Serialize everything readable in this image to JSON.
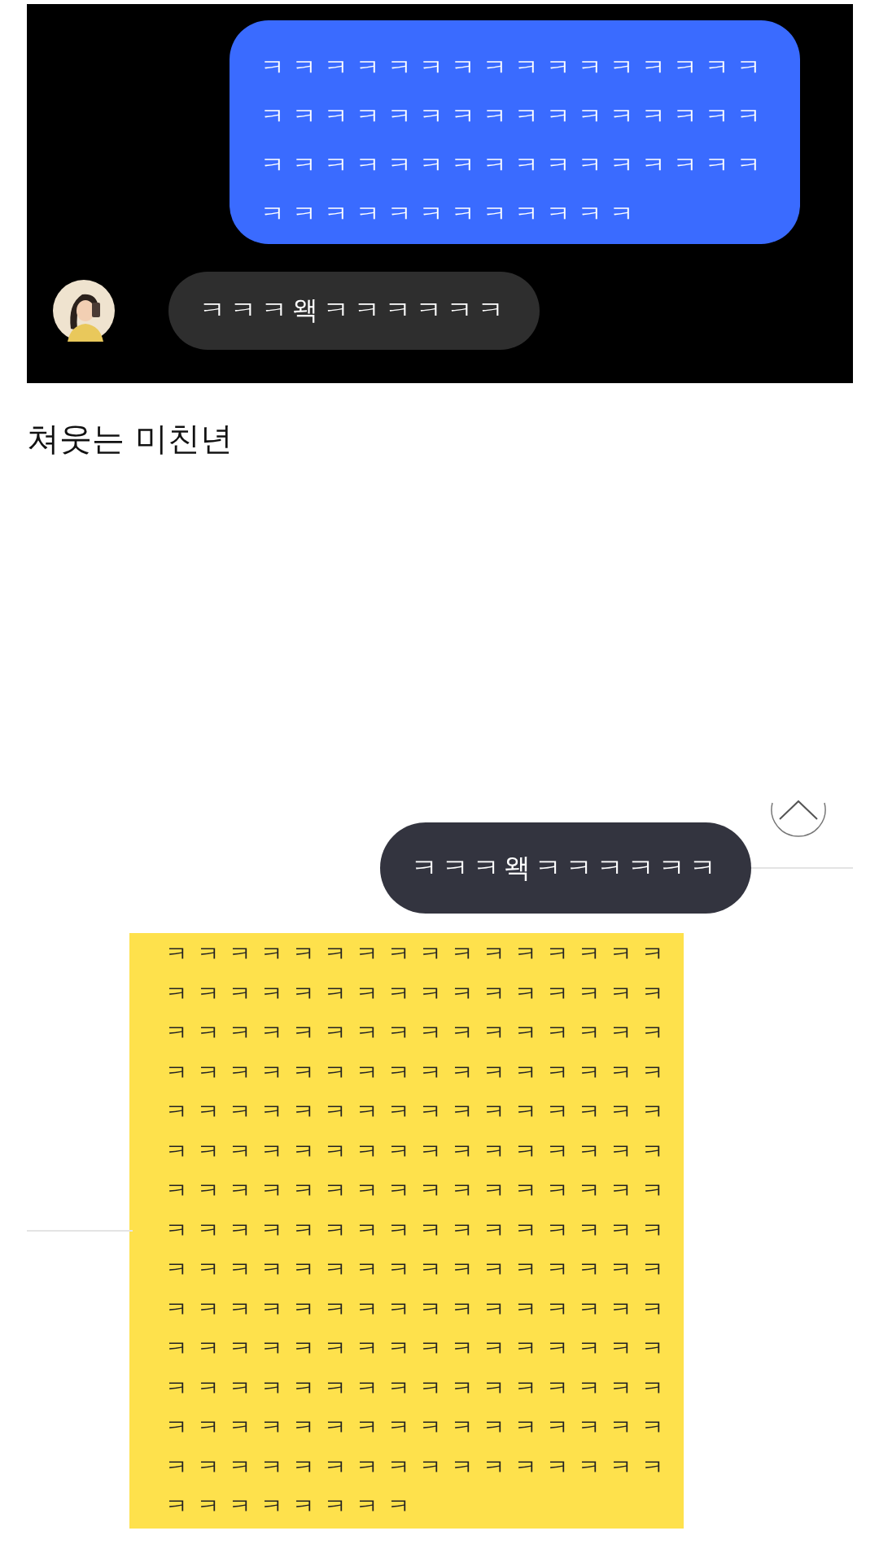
{
  "chat_screenshot": {
    "sent_message": {
      "lines": [
        "ㅋㅋㅋㅋㅋㅋㅋㅋㅋㅋㅋㅋㅋㅋㅋㅋ",
        "ㅋㅋㅋㅋㅋㅋㅋㅋㅋㅋㅋㅋㅋㅋㅋㅋ",
        "ㅋㅋㅋㅋㅋㅋㅋㅋㅋㅋㅋㅋㅋㅋㅋㅋ",
        "ㅋㅋㅋㅋㅋㅋㅋㅋㅋㅋㅋㅋ"
      ]
    },
    "received_message": {
      "text": "ㅋㅋㅋ왝ㅋㅋㅋㅋㅋㅋ"
    }
  },
  "caption": "쳐웃는 미친년",
  "reply_screenshot": {
    "message": {
      "text": "ㅋㅋㅋ왝ㅋㅋㅋㅋㅋㅋ"
    },
    "note_lines": [
      "ㅋㅋㅋㅋㅋㅋㅋㅋㅋㅋㅋㅋㅋㅋㅋㅋ",
      "ㅋㅋㅋㅋㅋㅋㅋㅋㅋㅋㅋㅋㅋㅋㅋㅋ",
      "ㅋㅋㅋㅋㅋㅋㅋㅋㅋㅋㅋㅋㅋㅋㅋㅋ",
      "ㅋㅋㅋㅋㅋㅋㅋㅋㅋㅋㅋㅋㅋㅋㅋㅋ",
      "ㅋㅋㅋㅋㅋㅋㅋㅋㅋㅋㅋㅋㅋㅋㅋㅋ",
      "ㅋㅋㅋㅋㅋㅋㅋㅋㅋㅋㅋㅋㅋㅋㅋㅋ",
      "ㅋㅋㅋㅋㅋㅋㅋㅋㅋㅋㅋㅋㅋㅋㅋㅋ",
      "ㅋㅋㅋㅋㅋㅋㅋㅋㅋㅋㅋㅋㅋㅋㅋㅋ",
      "ㅋㅋㅋㅋㅋㅋㅋㅋㅋㅋㅋㅋㅋㅋㅋㅋ",
      "ㅋㅋㅋㅋㅋㅋㅋㅋㅋㅋㅋㅋㅋㅋㅋㅋ",
      "ㅋㅋㅋㅋㅋㅋㅋㅋㅋㅋㅋㅋㅋㅋㅋㅋ",
      "ㅋㅋㅋㅋㅋㅋㅋㅋㅋㅋㅋㅋㅋㅋㅋㅋ",
      "ㅋㅋㅋㅋㅋㅋㅋㅋㅋㅋㅋㅋㅋㅋㅋㅋ",
      "ㅋㅋㅋㅋㅋㅋㅋㅋㅋㅋㅋㅋㅋㅋㅋㅋ",
      "ㅋㅋㅋㅋㅋㅋㅋㅋ"
    ]
  }
}
